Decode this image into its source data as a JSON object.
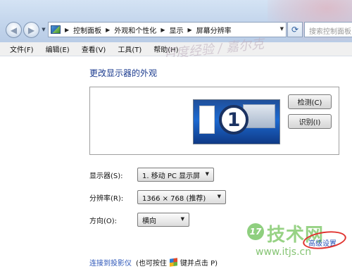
{
  "titlebar": {
    "breadcrumbs": [
      "控制面板",
      "外观和个性化",
      "显示",
      "屏幕分辨率"
    ],
    "search_placeholder": "搜索控制面板"
  },
  "menubar": {
    "items": [
      "文件(F)",
      "编辑(E)",
      "查看(V)",
      "工具(T)",
      "帮助(H)"
    ]
  },
  "main": {
    "title": "更改显示器的外观",
    "monitor_number": "1",
    "detect_label": "检测(C)",
    "identify_label": "识别(I)",
    "display_label": "显示器(S):",
    "display_value": "1. 移动 PC 显示屏",
    "resolution_label": "分辨率(R):",
    "resolution_value": "1366 × 768 (推荐)",
    "orientation_label": "方向(O):",
    "orientation_value": "横向",
    "advanced_link": "高级设置",
    "projector_link": "连接到投影仪",
    "projector_hint_pre": "(也可按住",
    "projector_hint_post": "键并点击 P)"
  },
  "watermarks": {
    "top_text": "百度经验 / 嘉尔克",
    "brand_badge": "17",
    "brand_text": "技术网",
    "brand_url": "www.itjs.cn"
  },
  "colors": {
    "link": "#2b55b8",
    "title": "#1a3a8e",
    "highlight_circle": "#e0322e"
  }
}
